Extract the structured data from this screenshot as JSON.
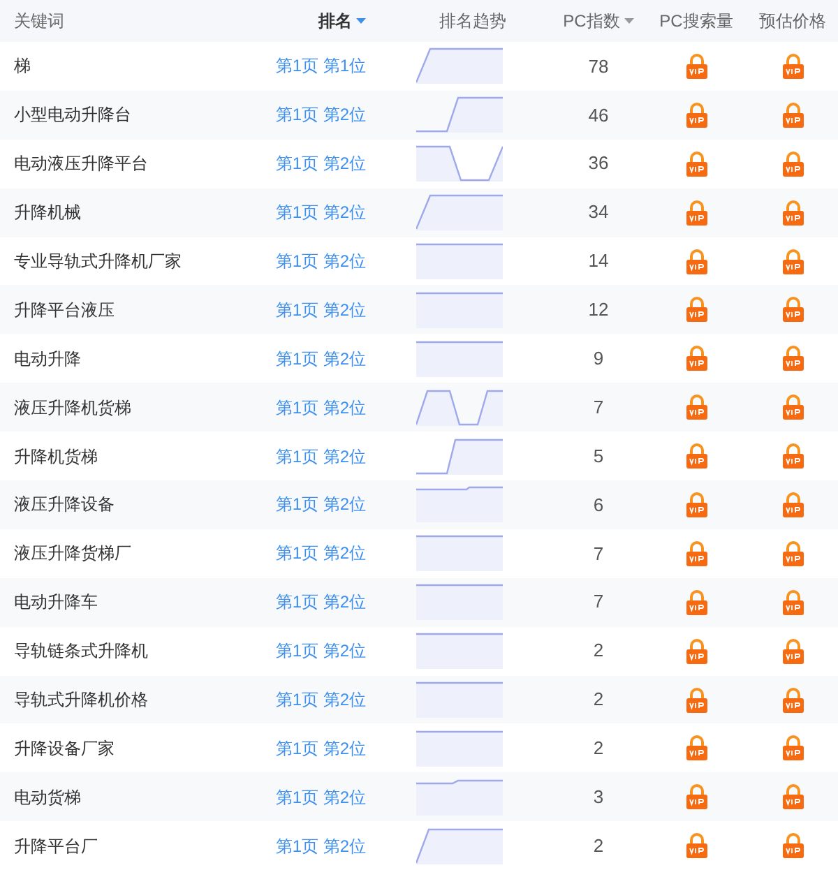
{
  "columns": [
    {
      "label": "关键词",
      "sortable": false,
      "sorted": false
    },
    {
      "label": "排名",
      "sortable": true,
      "sorted": true
    },
    {
      "label": "排名趋势",
      "sortable": false,
      "sorted": false
    },
    {
      "label": "PC指数",
      "sortable": true,
      "sorted": false
    },
    {
      "label": "PC搜索量",
      "sortable": false,
      "sorted": false
    },
    {
      "label": "预估价格",
      "sortable": false,
      "sorted": false
    }
  ],
  "rows": [
    {
      "keyword": "梯",
      "rank": "第1页 第1位",
      "pc_index": "78",
      "pc_search_locked": true,
      "price_locked": true
    },
    {
      "keyword": "小型电动升降台",
      "rank": "第1页 第2位",
      "pc_index": "46",
      "pc_search_locked": true,
      "price_locked": true
    },
    {
      "keyword": "电动液压升降平台",
      "rank": "第1页 第2位",
      "pc_index": "36",
      "pc_search_locked": true,
      "price_locked": true
    },
    {
      "keyword": "升降机械",
      "rank": "第1页 第2位",
      "pc_index": "34",
      "pc_search_locked": true,
      "price_locked": true
    },
    {
      "keyword": "专业导轨式升降机厂家",
      "rank": "第1页 第2位",
      "pc_index": "14",
      "pc_search_locked": true,
      "price_locked": true
    },
    {
      "keyword": "升降平台液压",
      "rank": "第1页 第2位",
      "pc_index": "12",
      "pc_search_locked": true,
      "price_locked": true
    },
    {
      "keyword": "电动升降",
      "rank": "第1页 第2位",
      "pc_index": "9",
      "pc_search_locked": true,
      "price_locked": true
    },
    {
      "keyword": "液压升降机货梯",
      "rank": "第1页 第2位",
      "pc_index": "7",
      "pc_search_locked": true,
      "price_locked": true
    },
    {
      "keyword": "升降机货梯",
      "rank": "第1页 第2位",
      "pc_index": "5",
      "pc_search_locked": true,
      "price_locked": true
    },
    {
      "keyword": "液压升降设备",
      "rank": "第1页 第2位",
      "pc_index": "6",
      "pc_search_locked": true,
      "price_locked": true
    },
    {
      "keyword": "液压升降货梯厂",
      "rank": "第1页 第2位",
      "pc_index": "7",
      "pc_search_locked": true,
      "price_locked": true
    },
    {
      "keyword": "电动升降车",
      "rank": "第1页 第2位",
      "pc_index": "7",
      "pc_search_locked": true,
      "price_locked": true
    },
    {
      "keyword": "导轨链条式升降机",
      "rank": "第1页 第2位",
      "pc_index": "2",
      "pc_search_locked": true,
      "price_locked": true
    },
    {
      "keyword": "导轨式升降机价格",
      "rank": "第1页 第2位",
      "pc_index": "2",
      "pc_search_locked": true,
      "price_locked": true
    },
    {
      "keyword": "升降设备厂家",
      "rank": "第1页 第2位",
      "pc_index": "2",
      "pc_search_locked": true,
      "price_locked": true
    },
    {
      "keyword": "电动货梯",
      "rank": "第1页 第2位",
      "pc_index": "3",
      "pc_search_locked": true,
      "price_locked": true
    },
    {
      "keyword": "升降平台厂",
      "rank": "第1页 第2位",
      "pc_index": "2",
      "pc_search_locked": true,
      "price_locked": true
    }
  ]
}
